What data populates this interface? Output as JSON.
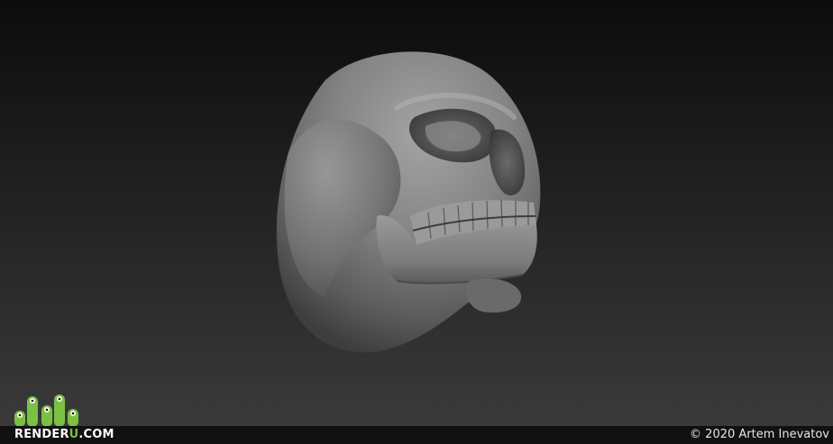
{
  "render": {
    "subject": "skull-icon"
  },
  "branding": {
    "logo_main": "RENDER",
    "logo_accent": "U",
    "logo_suffix": ".COM",
    "logo_icon": "figures-icon",
    "accent_color": "#7ac143"
  },
  "footer": {
    "copyright": "© 2020 Artem Inevatov"
  }
}
